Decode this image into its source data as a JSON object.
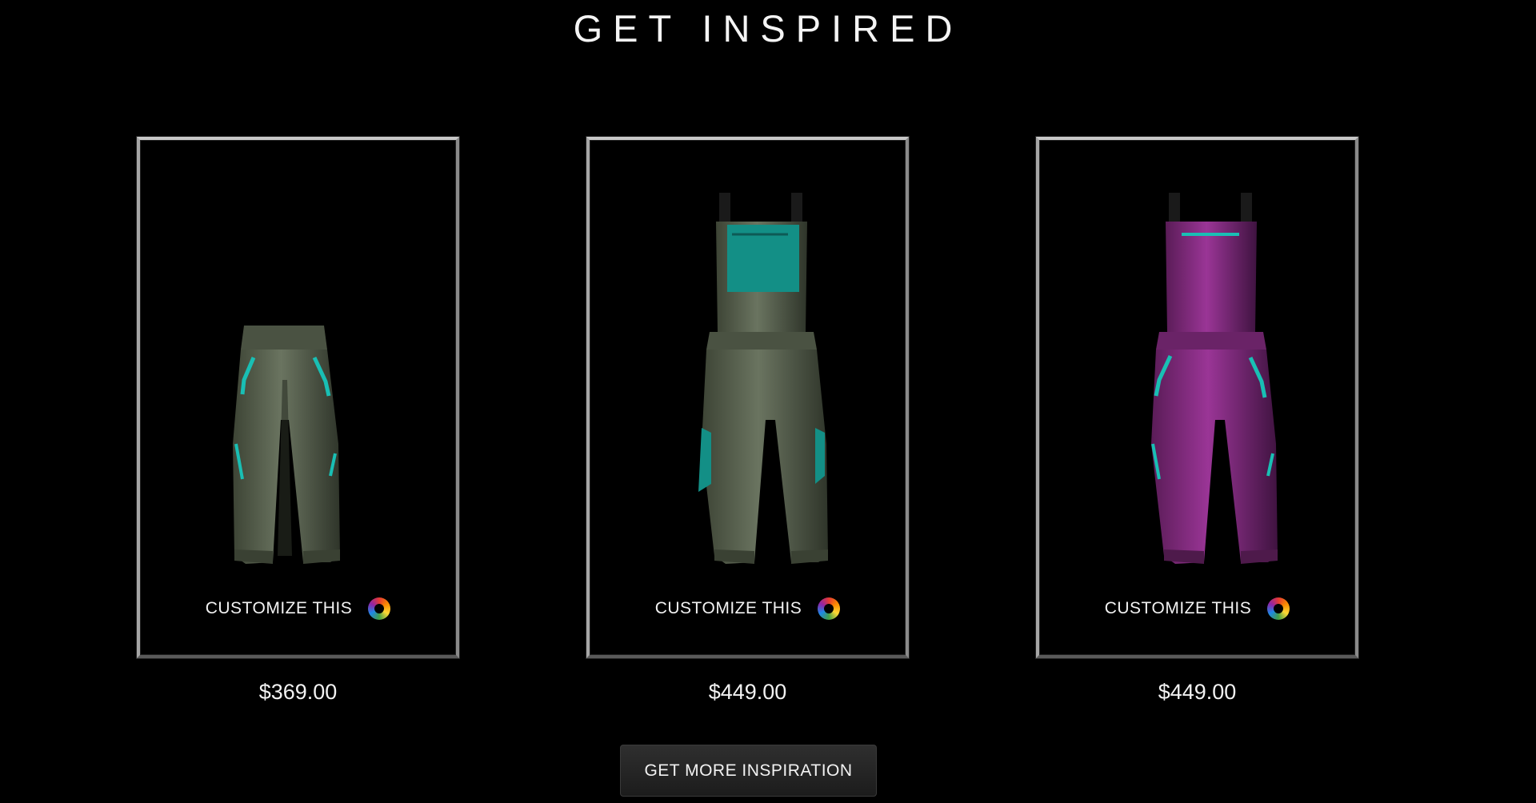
{
  "section": {
    "title": "GET INSPIRED"
  },
  "products": [
    {
      "name": "olive-pants",
      "customize_label": "CUSTOMIZE THIS",
      "price": "$369.00",
      "colors": {
        "body": "#5d6650",
        "accent": "#19bfb4"
      }
    },
    {
      "name": "olive-bib",
      "customize_label": "CUSTOMIZE THIS",
      "price": "$449.00",
      "colors": {
        "body": "#5d6650",
        "accent": "#138f86"
      }
    },
    {
      "name": "purple-bib",
      "customize_label": "CUSTOMIZE THIS",
      "price": "$449.00",
      "colors": {
        "body": "#8a2d86",
        "accent": "#19bfb4"
      }
    }
  ],
  "more_button": {
    "label": "GET MORE INSPIRATION"
  },
  "icons": {
    "customize": "color-wheel-icon"
  }
}
